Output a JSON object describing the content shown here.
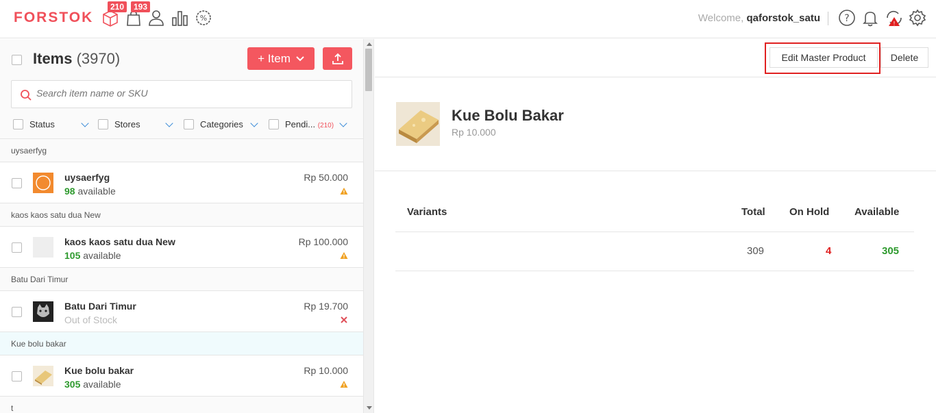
{
  "header": {
    "logo": "FORSTOK",
    "badges": {
      "products": "210",
      "orders": "193"
    },
    "welcome_prefix": "Welcome, ",
    "username": "qaforstok_satu"
  },
  "items_panel": {
    "title": "Items",
    "count": "(3970)",
    "add_button_label": "+ Item",
    "search_placeholder": "Search item name or SKU",
    "filters": [
      {
        "label": "Status"
      },
      {
        "label": "Stores"
      },
      {
        "label": "Categories"
      },
      {
        "label": "Pendi...",
        "count": "(210)"
      }
    ],
    "groups": [
      {
        "heading": "uysaerfyg",
        "name": "uysaerfyg",
        "available_num": "98",
        "available_text": " available",
        "price": "Rp 50.000",
        "status": "warning"
      },
      {
        "heading": "kaos kaos satu dua New",
        "name": "kaos kaos satu dua New",
        "available_num": "105",
        "available_text": " available",
        "price": "Rp 100.000",
        "status": "warning"
      },
      {
        "heading": "Batu Dari Timur",
        "name": "Batu Dari Timur",
        "available_num": "",
        "available_text": "Out of Stock",
        "price": "Rp 19.700",
        "status": "error"
      },
      {
        "heading": "Kue bolu bakar",
        "name": "Kue bolu bakar",
        "available_num": "305",
        "available_text": " available",
        "price": "Rp 10.000",
        "status": "warning"
      },
      {
        "heading": "t"
      }
    ]
  },
  "detail": {
    "edit_button": "Edit Master Product",
    "delete_button": "Delete",
    "product_name": "Kue Bolu Bakar",
    "product_price": "Rp 10.000",
    "variants_table": {
      "headers": [
        "Variants",
        "Total",
        "On Hold",
        "Available"
      ],
      "row": {
        "variant": "",
        "total": "309",
        "on_hold": "4",
        "available": "305"
      }
    }
  },
  "colors": {
    "brand": "#f0505a",
    "available": "#2e9a2e",
    "on_hold": "#e02020",
    "highlight_outline": "#e02020"
  }
}
